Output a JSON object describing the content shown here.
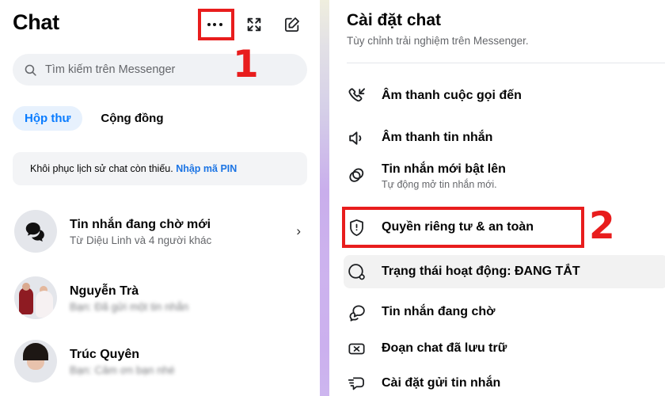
{
  "left_panel": {
    "title": "Chat",
    "header_icons": [
      {
        "name": "more-options-icon",
        "label": "..."
      },
      {
        "name": "expand-icon",
        "label": "Expand"
      },
      {
        "name": "compose-icon",
        "label": "New message"
      }
    ],
    "search": {
      "placeholder": "Tìm kiếm trên Messenger",
      "value": "",
      "icon": "search-icon"
    },
    "tabs": [
      {
        "label": "Hộp thư",
        "active": true
      },
      {
        "label": "Cộng đồng",
        "active": false
      }
    ],
    "banner": {
      "text": "Khôi phục lịch sử chat còn thiếu.",
      "link": "Nhập mã PIN"
    },
    "chats": [
      {
        "name": "Tin nhắn đang chờ mới",
        "preview": "Từ Diệu Linh và 4 người khác",
        "avatar": "message-bubbles-icon",
        "blurred": false,
        "chevron": "›"
      },
      {
        "name": "Nguyễn Trà",
        "preview": "Bạn: Đã gửi một tin nhắn",
        "avatar": "photo-wedding",
        "blurred": true,
        "chevron": ""
      },
      {
        "name": "Trúc Quyên",
        "preview": "Bạn: Cảm ơn bạn nhé",
        "avatar": "photo-portrait",
        "blurred": true,
        "chevron": ""
      }
    ]
  },
  "right_panel": {
    "title": "Cài đặt chat",
    "subtitle": "Tùy chỉnh trải nghiệm trên Messenger.",
    "settings": [
      {
        "label": "Âm thanh cuộc gọi đến",
        "sublabel": "",
        "icon": "incoming-call-icon",
        "control": "toggle",
        "state": "on"
      },
      {
        "label": "Âm thanh tin nhắn",
        "sublabel": "",
        "icon": "speaker-icon",
        "control": "toggle",
        "state": "on"
      },
      {
        "label": "Tin nhắn mới bật lên",
        "sublabel": "Tự động mở tin nhắn mới.",
        "icon": "popup-messages-icon",
        "control": "toggle",
        "state": "off"
      },
      {
        "label": "Quyền riêng tư & an toàn",
        "sublabel": "",
        "icon": "shield-icon",
        "control": "chevron",
        "state": ""
      },
      {
        "label": "Trạng thái hoạt động: ĐANG TẮT",
        "sublabel": "",
        "icon": "active-status-icon",
        "control": "none",
        "state": "highlighted"
      },
      {
        "label": "Tin nhắn đang chờ",
        "sublabel": "",
        "icon": "pending-messages-icon",
        "control": "none",
        "state": ""
      },
      {
        "label": "Đoạn chat đã lưu trữ",
        "sublabel": "",
        "icon": "archived-chats-icon",
        "control": "none",
        "state": ""
      },
      {
        "label": "Cài đặt gửi tin nhắn",
        "sublabel": "",
        "icon": "send-settings-icon",
        "control": "none",
        "state": ""
      }
    ],
    "chevron_glyph": "›"
  },
  "annotations": {
    "markers": [
      {
        "label": "1",
        "color": "#e81d1d"
      },
      {
        "label": "2",
        "color": "#e81d1d"
      }
    ],
    "highlight_color": "#e81d1d"
  },
  "theme": {
    "accent_blue": "#1877f2",
    "link_blue": "#1b74e4",
    "tab_active_bg": "#e7f1fd",
    "surface_gray": "#f0f2f5",
    "text_secondary": "#65676b"
  }
}
